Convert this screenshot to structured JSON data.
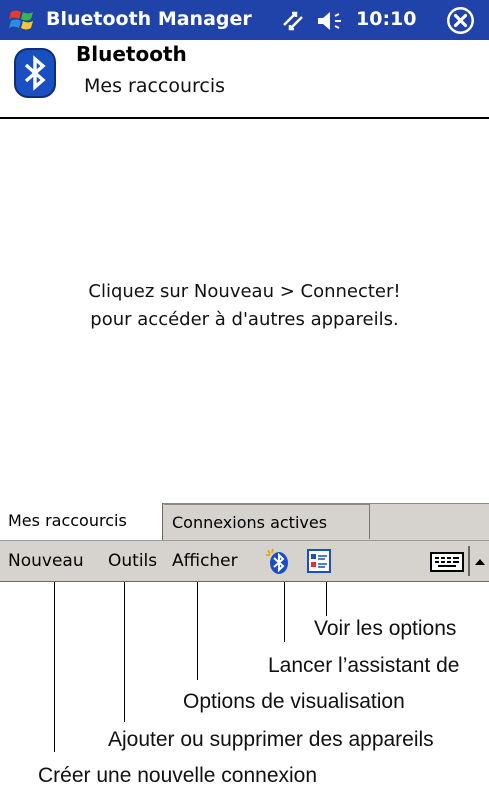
{
  "titlebar": {
    "title": "Bluetooth Manager",
    "time": "10:10",
    "icons": [
      "windows-start-icon",
      "connectivity-icon",
      "volume-icon",
      "close-icon"
    ],
    "colors": {
      "background": "#1f43a8",
      "text": "#ffffff"
    }
  },
  "header": {
    "title": "Bluetooth",
    "subtitle": "Mes raccourcis",
    "icon": "bluetooth-icon"
  },
  "main": {
    "message_line1": "Cliquez sur Nouveau > Connecter!",
    "message_line2": "pour accéder à d'autres appareils."
  },
  "tabs": [
    {
      "label": "Mes raccourcis",
      "active": true
    },
    {
      "label": "Connexions actives",
      "active": false
    }
  ],
  "commandbar": {
    "menus": [
      "Nouveau",
      "Outils",
      "Afficher"
    ],
    "icons": [
      "bluetooth-wizard-icon",
      "view-options-icon",
      "keyboard-icon",
      "input-panel-arrow-icon"
    ],
    "background": "#d6d3ce"
  },
  "callouts": {
    "view_options": "Voir les options",
    "wizard": "Lancer l’assistant de",
    "display_options": "Options de visualisation",
    "add_remove": "Ajouter ou supprimer des appareils",
    "new_connection": "Créer une nouvelle connexion"
  }
}
